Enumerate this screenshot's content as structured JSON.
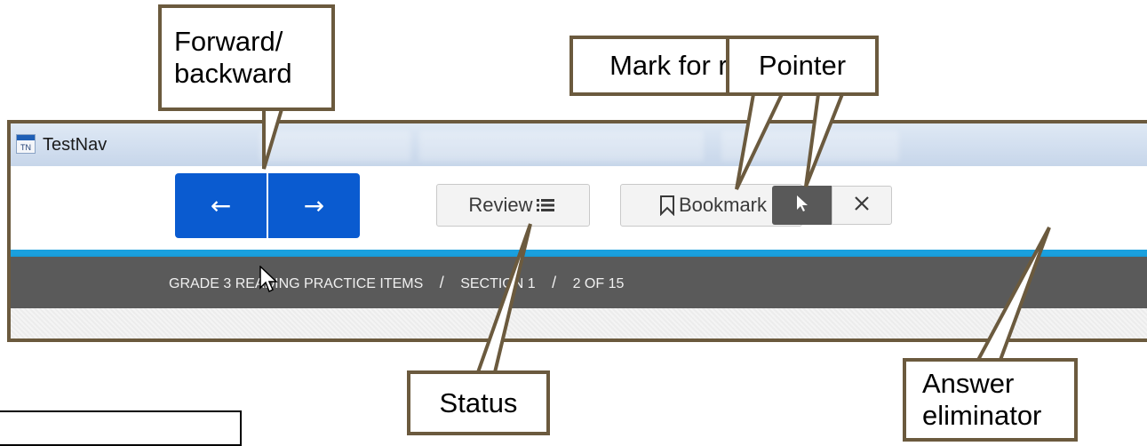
{
  "window": {
    "title": "TestNav",
    "logo_text": "TN"
  },
  "toolbar": {
    "back_icon": "arrow-left-icon",
    "forward_icon": "arrow-right-icon",
    "review_label": "Review",
    "bookmark_label": "Bookmark",
    "pointer_icon": "pointer-icon",
    "eliminator_icon": "close-icon"
  },
  "breadcrumb": {
    "test": "GRADE 3 READING PRACTICE ITEMS",
    "section": "SECTION 1",
    "position": "2 OF 15",
    "separator": "/"
  },
  "callouts": {
    "nav": "Forward/ backward",
    "bookmark": "Mark for review.",
    "pointer": "Pointer",
    "status": "Status",
    "eliminator": "Answer eliminator"
  },
  "colors": {
    "nav_button": "#0a5bd0",
    "accent_band": "#1aa0de",
    "breadcrumb_bar": "#5a5a5a",
    "callout_border": "#6b5a3e",
    "pointer_active": "#595959"
  }
}
